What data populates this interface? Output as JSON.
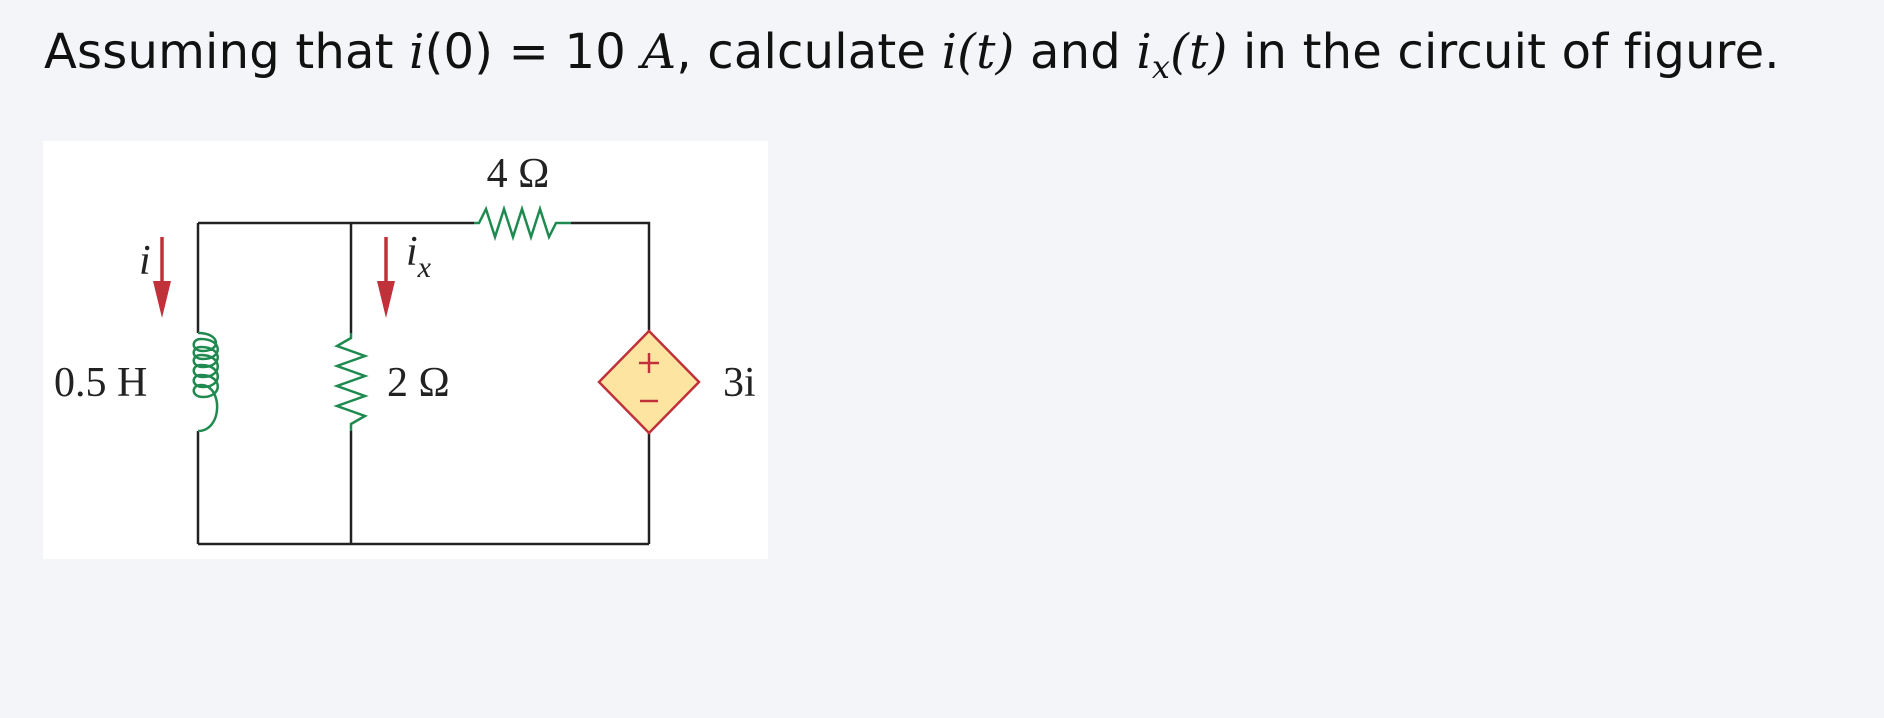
{
  "problem": {
    "part1": "Assuming that ",
    "i0_var": "i",
    "i0_arg": "(0)",
    "eq": " = 10 ",
    "unit": "A",
    "part2": ", calculate ",
    "it_var": "i",
    "it_arg": "(t)",
    "and": " and ",
    "ix_var": "i",
    "ix_sub": "x",
    "ix_arg": "(t)",
    "part3": " in the circuit of figure."
  },
  "circuit": {
    "resistor_top": "4 Ω",
    "resistor_mid": "2 Ω",
    "inductor": "0.5 H",
    "current_i": "i",
    "current_ix_var": "i",
    "current_ix_sub": "x",
    "source_value": "3i",
    "source_plus": "+",
    "source_minus": "−",
    "colors": {
      "wire": "#222222",
      "resistor": "#1e8a4f",
      "inductor": "#1e8a4f",
      "arrow": "#c0313a",
      "source_fill": "#fde5a1",
      "source_stroke": "#c0313a"
    }
  }
}
